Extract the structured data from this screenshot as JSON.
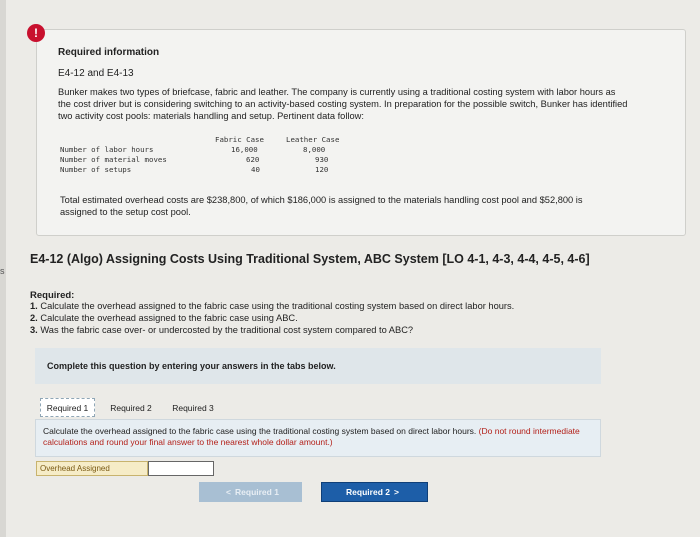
{
  "alert": {
    "icon": "exclamation-icon",
    "glyph": "!",
    "color": "#c8102e"
  },
  "info": {
    "title": "Required information",
    "subtitle": "E4-12 and E4-13",
    "paragraph": "Bunker makes two types of briefcase, fabric and leather. The company is currently using a traditional costing system with labor hours as the cost driver but is considering switching to an activity-based costing system. In preparation for the possible switch, Bunker has identified two activity cost pools: materials handling and setup. Pertinent data follow:",
    "table": {
      "headers": [
        "Fabric Case",
        "Leather Case"
      ],
      "rows": [
        {
          "label": "Number of labor hours",
          "fabric": "16,000",
          "leather": "8,000"
        },
        {
          "label": "Number of material moves",
          "fabric": "620",
          "leather": "930"
        },
        {
          "label": "Number of setups",
          "fabric": "40",
          "leather": "120"
        }
      ]
    },
    "paragraph2": "Total estimated overhead costs are $238,800, of which $186,000 is assigned to the materials handling cost pool and $52,800 is assigned to the setup cost pool."
  },
  "problem": {
    "title": "E4-12 (Algo) Assigning Costs Using Traditional System, ABC System [LO 4-1, 4-3, 4-4, 4-5, 4-6]",
    "required_label": "Required:",
    "requirements": [
      {
        "num": "1.",
        "text": "Calculate the overhead assigned to the fabric case using the traditional costing system based on direct labor hours."
      },
      {
        "num": "2.",
        "text": "Calculate the overhead assigned to the fabric case using ABC."
      },
      {
        "num": "3.",
        "text": "Was the fabric case over- or undercosted by the traditional cost system compared to ABC?"
      }
    ]
  },
  "complete_prompt": "Complete this question by entering your answers in the tabs below.",
  "tabs": [
    {
      "label": "Required 1",
      "active": true
    },
    {
      "label": "Required 2",
      "active": false
    },
    {
      "label": "Required 3",
      "active": false
    }
  ],
  "question": {
    "text": "Calculate the overhead assigned to the fabric case using the traditional costing system based on direct labor hours.",
    "note": "(Do not round intermediate calculations and round your final answer to the nearest whole dollar amount.)"
  },
  "answer": {
    "label": "Overhead Assigned",
    "value": ""
  },
  "nav": {
    "prev_label": "Required 1",
    "next_label": "Required 2",
    "prev_glyph": "<",
    "next_glyph": ">"
  },
  "edge_mark": "s",
  "colors": {
    "accent": "#1d5ea8",
    "alert": "#c8102e",
    "answer_label_bg": "#f6ecc7"
  }
}
